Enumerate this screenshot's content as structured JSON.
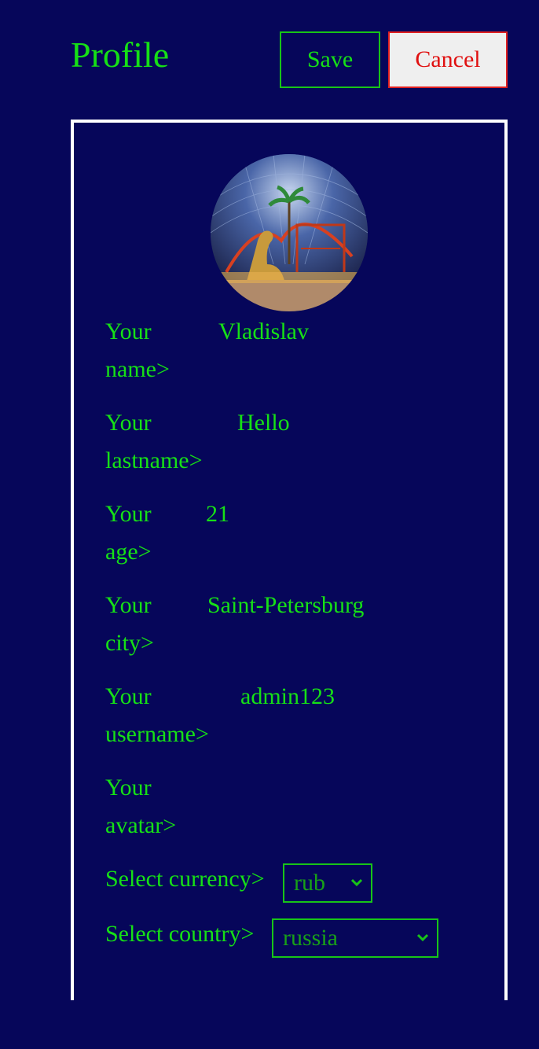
{
  "header": {
    "title": "Profile",
    "save_label": "Save",
    "cancel_label": "Cancel"
  },
  "colors": {
    "background": "#06065a",
    "text": "#16e016",
    "cancel_text": "#e01010",
    "card_border": "#ffffff"
  },
  "profile": {
    "avatar_icon": "avatar-photo-icon",
    "fields": {
      "name": {
        "label": "Your name>",
        "value": "Vladislav"
      },
      "lastname": {
        "label": "Your lastname>",
        "value": "Hello"
      },
      "age": {
        "label": "Your age>",
        "value": "21"
      },
      "city": {
        "label": "Your city>",
        "value": "Saint-Petersburg"
      },
      "username": {
        "label": "Your username>",
        "value": "admin123"
      },
      "avatar": {
        "label": "Your avatar>",
        "value": ""
      }
    },
    "currency": {
      "label": "Select currency>",
      "selected": "rub"
    },
    "country": {
      "label": "Select country>",
      "selected": "russia"
    }
  }
}
